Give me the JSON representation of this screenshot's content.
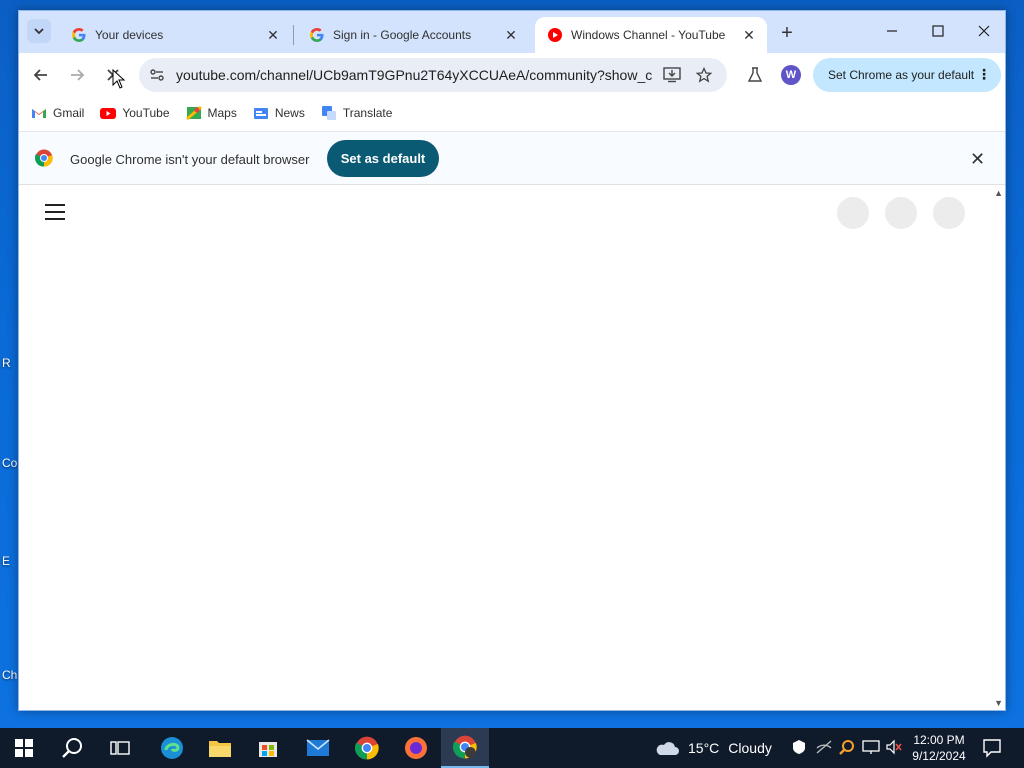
{
  "tabs": [
    {
      "title": "Your devices",
      "icon": "google-g"
    },
    {
      "title": "Sign in - Google Accounts",
      "icon": "google-g"
    },
    {
      "title": "Windows Channel - YouTube",
      "icon": "youtube",
      "active": true
    }
  ],
  "toolbar": {
    "url": "youtube.com/channel/UCb9amT9GPnu2T64yXCCUAeA/community?show_c...",
    "avatar_letter": "W",
    "set_default_label": "Set Chrome as your default"
  },
  "bookmarks": [
    {
      "label": "Gmail",
      "icon": "gmail-icon"
    },
    {
      "label": "YouTube",
      "icon": "youtube-icon"
    },
    {
      "label": "Maps",
      "icon": "maps-icon"
    },
    {
      "label": "News",
      "icon": "news-icon"
    },
    {
      "label": "Translate",
      "icon": "translate-icon"
    }
  ],
  "infobar": {
    "message": "Google Chrome isn't your default browser",
    "button_label": "Set as default"
  },
  "desktop_labels": [
    "R",
    "Co",
    "E",
    "Ch"
  ],
  "taskbar": {
    "weather": {
      "temp": "15°C",
      "condition": "Cloudy"
    },
    "time": "12:00 PM",
    "date": "9/12/2024"
  },
  "colors": {
    "tabstrip": "#d3e3fd",
    "omnibox": "#e9eef6",
    "infobar_button": "#0b5a73",
    "set_default_pill": "#c2e7ff",
    "taskbar": "#0f1a2b"
  }
}
